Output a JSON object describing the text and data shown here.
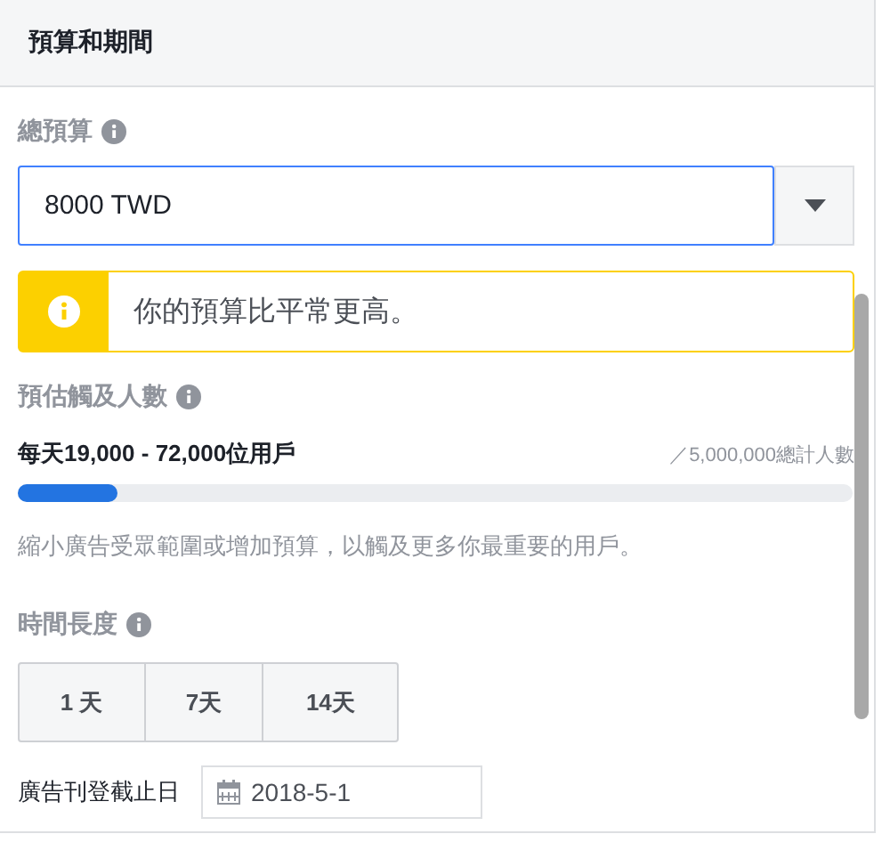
{
  "header": {
    "title": "預算和期間"
  },
  "budget": {
    "label": "總預算",
    "value": "8000 TWD"
  },
  "notice": {
    "text": "你的預算比平常更高。"
  },
  "reach": {
    "label": "預估觸及人數",
    "range": "每天19,000 - 72,000位用戶",
    "total": "／5,000,000總計人數",
    "level": 0.12,
    "hint": "縮小廣告受眾範圍或增加預算，以觸及更多你最重要的用戶。"
  },
  "duration": {
    "label": "時間長度",
    "options": [
      {
        "label": "1 天"
      },
      {
        "label": "7天"
      },
      {
        "label": "14天"
      }
    ]
  },
  "end_date": {
    "label": "廣告刊登截止日",
    "value": "2018-5-1"
  }
}
